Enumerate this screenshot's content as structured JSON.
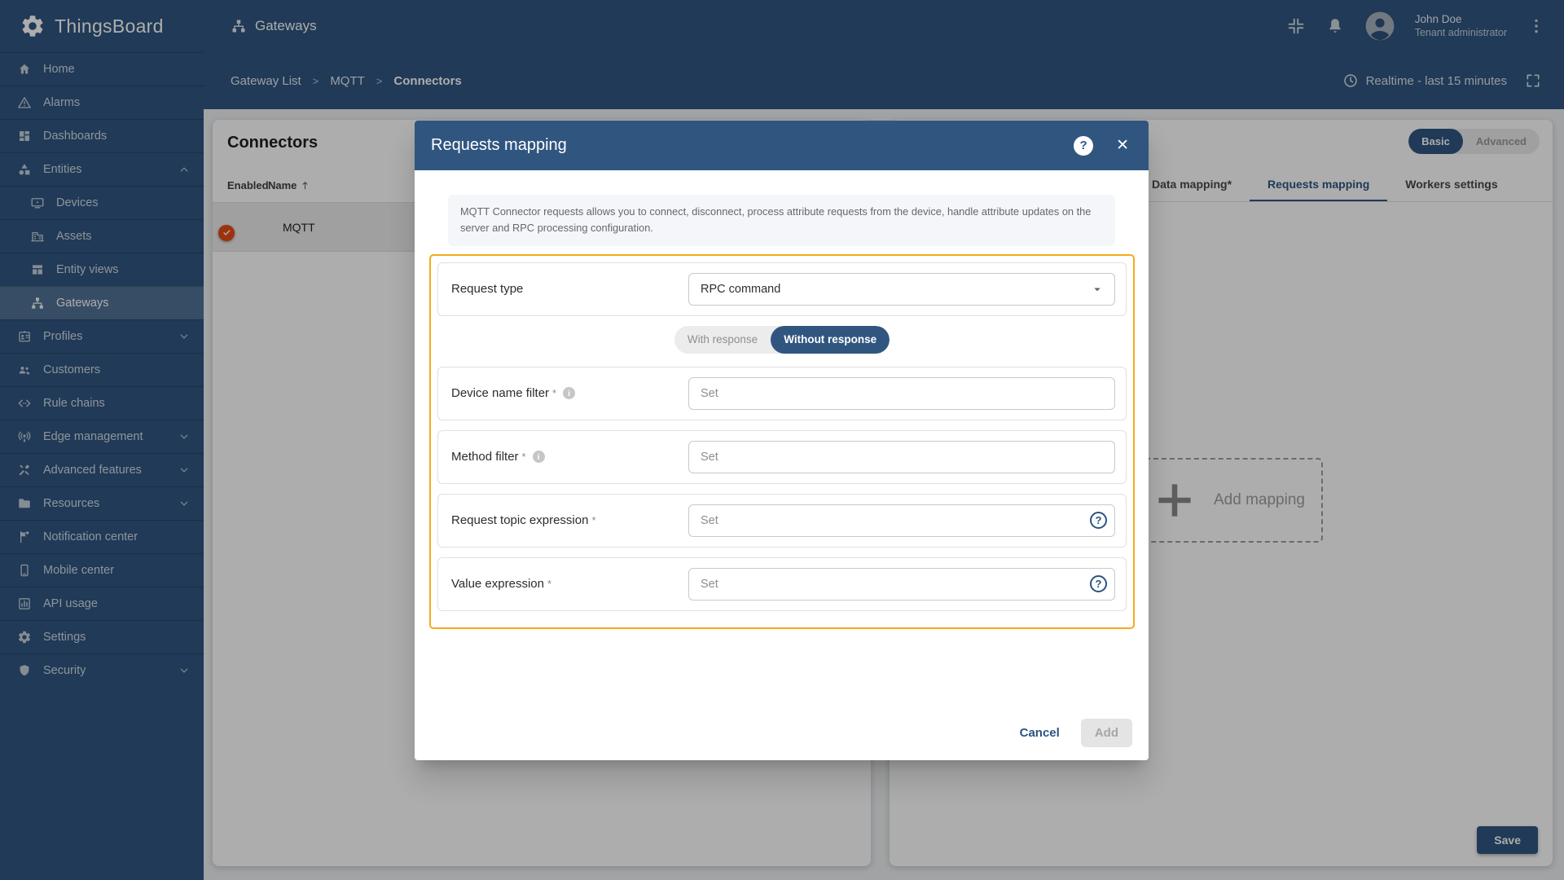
{
  "colors": {
    "primary": "#305680",
    "warning_border": "#f4ab19",
    "toggle_on": "#e64a19",
    "backdrop": "rgba(0,0,0,0.32)"
  },
  "topbar": {
    "logo_text": "ThingsBoard",
    "page_title": "Gateways",
    "user": {
      "name": "John Doe",
      "role": "Tenant administrator"
    }
  },
  "breadcrumb": {
    "separator": ">",
    "items": [
      {
        "label": "Gateway List",
        "current": false
      },
      {
        "label": "MQTT",
        "current": false
      },
      {
        "label": "Connectors",
        "current": true
      }
    ]
  },
  "time_toolbar": {
    "label": "Realtime - last 15 minutes"
  },
  "sidebar": {
    "items": [
      {
        "label": "Home",
        "icon": "home-icon"
      },
      {
        "label": "Alarms",
        "icon": "alarms-icon"
      },
      {
        "label": "Dashboards",
        "icon": "dashboards-icon"
      },
      {
        "label": "Entities",
        "icon": "entities-icon",
        "chevron": "up"
      },
      {
        "label": "Devices",
        "icon": "devices-icon",
        "child": true
      },
      {
        "label": "Assets",
        "icon": "assets-icon",
        "child": true
      },
      {
        "label": "Entity views",
        "icon": "entity-views-icon",
        "child": true
      },
      {
        "label": "Gateways",
        "icon": "gateways-icon",
        "child": true,
        "selected": true
      },
      {
        "label": "Profiles",
        "icon": "profiles-icon",
        "chevron": "down"
      },
      {
        "label": "Customers",
        "icon": "customers-icon"
      },
      {
        "label": "Rule chains",
        "icon": "rule-chains-icon"
      },
      {
        "label": "Edge management",
        "icon": "edge-management-icon",
        "chevron": "down"
      },
      {
        "label": "Advanced features",
        "icon": "advanced-features-icon",
        "chevron": "down"
      },
      {
        "label": "Resources",
        "icon": "resources-icon",
        "chevron": "down"
      },
      {
        "label": "Notification center",
        "icon": "notification-center-icon"
      },
      {
        "label": "Mobile center",
        "icon": "mobile-center-icon"
      },
      {
        "label": "API usage",
        "icon": "api-usage-icon"
      },
      {
        "label": "Settings",
        "icon": "settings-icon"
      },
      {
        "label": "Security",
        "icon": "security-icon",
        "chevron": "down"
      }
    ]
  },
  "connectors_panel": {
    "title": "Connectors",
    "columns": [
      {
        "label": "Enabled",
        "sortable": false
      },
      {
        "label": "Name",
        "sortable": true,
        "sort": "asc"
      }
    ],
    "rows": [
      {
        "name": "MQTT",
        "enabled": true,
        "selected": true
      }
    ]
  },
  "gateway_panel": {
    "mode_toggle": {
      "options": [
        "Basic",
        "Advanced"
      ],
      "selected": "Basic"
    },
    "tabs": [
      {
        "label": "Data mapping*",
        "active": false
      },
      {
        "label": "Requests mapping",
        "active": true
      },
      {
        "label": "Workers settings",
        "active": false
      }
    ],
    "add_mapping_label": "Add mapping",
    "save_label": "Save"
  },
  "modal": {
    "title": "Requests mapping",
    "description": "MQTT Connector requests allows you to connect, disconnect, process attribute requests from the device, handle attribute updates on the server and RPC processing configuration.",
    "request_type": {
      "label": "Request type",
      "value": "RPC command"
    },
    "response_toggle": {
      "options": [
        "With response",
        "Without response"
      ],
      "selected": "Without response"
    },
    "fields": [
      {
        "label": "Device name filter",
        "required": true,
        "leading_icon": "info-icon",
        "trailing_icon": null,
        "placeholder": "Set"
      },
      {
        "label": "Method filter",
        "required": true,
        "leading_icon": "info-icon",
        "trailing_icon": null,
        "placeholder": "Set"
      },
      {
        "label": "Request topic expression",
        "required": true,
        "leading_icon": null,
        "trailing_icon": "help-icon",
        "placeholder": "Set"
      },
      {
        "label": "Value expression",
        "required": true,
        "leading_icon": null,
        "trailing_icon": "help-icon",
        "placeholder": "Set"
      }
    ],
    "footer": {
      "cancel_label": "Cancel",
      "add_label": "Add",
      "add_disabled": true
    }
  }
}
